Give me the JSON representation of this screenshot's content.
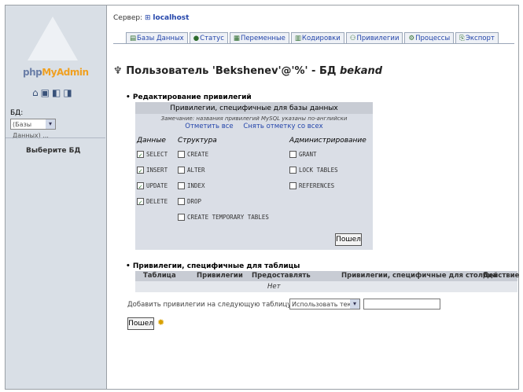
{
  "left": {
    "logo_text_a": "php",
    "logo_text_b": "MyAdmin",
    "icons": [
      "home-icon",
      "sql-icon",
      "query-icon",
      "docs-icon"
    ],
    "db_label": "БД:",
    "db_select_value": "(Базы Данных) ...",
    "choose_db": "Выберите БД"
  },
  "header": {
    "server_label": "Сервер:",
    "server_value": "localhost"
  },
  "tabs": [
    {
      "label": "Базы Данных",
      "icon": "db-icon"
    },
    {
      "label": "Статус",
      "icon": "status-icon"
    },
    {
      "label": "Переменные",
      "icon": "vars-icon"
    },
    {
      "label": "Кодировки",
      "icon": "charset-icon"
    },
    {
      "label": "Привилегии",
      "icon": "users-icon"
    },
    {
      "label": "Процессы",
      "icon": "process-icon"
    },
    {
      "label": "Экспорт",
      "icon": "export-icon"
    }
  ],
  "title": {
    "prefix": "Пользователь",
    "user": "'Bekshenev'@'%'",
    "separator": " - БД ",
    "db": "bekand"
  },
  "section1": {
    "title": "Редактирование привилегий",
    "table_header": "Привилегии, специфичные для базы данных",
    "note": "Замечание: названия привилегий MySQL указаны по-английски",
    "check_all": "Отметить все",
    "uncheck_all": "Снять отметку со всех",
    "col_data": "Данные",
    "col_structure": "Структура",
    "col_admin": "Администрирование",
    "data_privs": [
      {
        "label": "SELECT",
        "checked": true
      },
      {
        "label": "INSERT",
        "checked": true
      },
      {
        "label": "UPDATE",
        "checked": true
      },
      {
        "label": "DELETE",
        "checked": true
      }
    ],
    "structure_privs": [
      {
        "label": "CREATE",
        "checked": false
      },
      {
        "label": "ALTER",
        "checked": false
      },
      {
        "label": "INDEX",
        "checked": false
      },
      {
        "label": "DROP",
        "checked": false
      },
      {
        "label": "CREATE TEMPORARY TABLES",
        "checked": false
      }
    ],
    "admin_privs": [
      {
        "label": "GRANT",
        "checked": false
      },
      {
        "label": "LOCK TABLES",
        "checked": false
      },
      {
        "label": "REFERENCES",
        "checked": false
      }
    ],
    "go_button": "Пошел"
  },
  "section2": {
    "title": "Привилегии, специфичные для таблицы",
    "headers": [
      "Таблица",
      "Привилегии",
      "Предоставлять",
      "Привилегии, специфичные для столбца",
      "Действие"
    ],
    "empty_row": "Нет",
    "add_label": "Добавить привилегии на следующую таблицу:",
    "select_value": "Использовать текстовое поле:",
    "go_button": "Пошел"
  }
}
